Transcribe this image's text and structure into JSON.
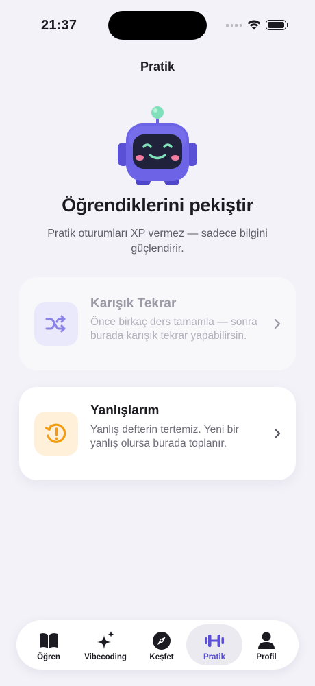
{
  "status_bar": {
    "time": "21:37"
  },
  "nav": {
    "title": "Pratik"
  },
  "hero": {
    "title": "Öğrendiklerini pekiştir",
    "subtitle": "Pratik oturumları XP vermez — sadece bilgini güçlendirir."
  },
  "cards": [
    {
      "title": "Karışık Tekrar",
      "description": "Önce birkaç ders tamamla — sonra burada karışık tekrar yapabilirsin.",
      "icon": "shuffle-icon",
      "enabled": false,
      "accent": "#7b72e0"
    },
    {
      "title": "Yanlışlarım",
      "description": "Yanlış defterin tertemiz. Yeni bir yanlış olursa burada toplanır.",
      "icon": "history-alert-icon",
      "enabled": true,
      "accent": "#f39c12"
    }
  ],
  "tabs": [
    {
      "label": "Öğren",
      "icon": "book-icon"
    },
    {
      "label": "Vibecoding",
      "icon": "sparkles-icon"
    },
    {
      "label": "Keşfet",
      "icon": "compass-icon"
    },
    {
      "label": "Pratik",
      "icon": "dumbbell-icon",
      "active": true
    },
    {
      "label": "Profil",
      "icon": "person-icon"
    }
  ],
  "colors": {
    "background": "#f3f2f8",
    "accent": "#5b4fd8",
    "mascot": "#6c63e6",
    "warning": "#f39c12"
  }
}
